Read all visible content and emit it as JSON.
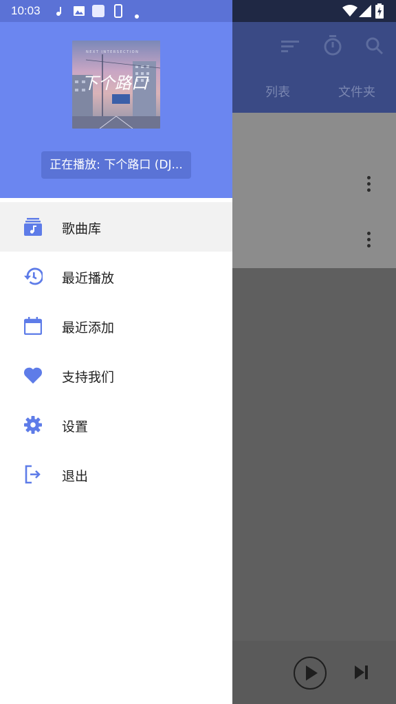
{
  "status_bar": {
    "time": "10:03",
    "icons": [
      "music-note-icon",
      "image-icon",
      "square-icon",
      "phone-icon",
      "dot-icon",
      "wifi-icon",
      "signal-icon",
      "battery-charging-icon"
    ]
  },
  "drawer": {
    "now_playing": "正在播放: 下个路口 (DJ...",
    "album_art_text": "下个路口",
    "album_art_caption": "NEXT INTERSECTION",
    "menu": [
      {
        "label": "歌曲库",
        "icon": "library-music-icon",
        "active": true
      },
      {
        "label": "最近播放",
        "icon": "history-icon",
        "active": false
      },
      {
        "label": "最近添加",
        "icon": "calendar-icon",
        "active": false
      },
      {
        "label": "支持我们",
        "icon": "heart-icon",
        "active": false
      },
      {
        "label": "设置",
        "icon": "gear-icon",
        "active": false
      },
      {
        "label": "退出",
        "icon": "logout-icon",
        "active": false
      }
    ]
  },
  "background_app": {
    "tabs": [
      "列表",
      "文件夹"
    ],
    "toolbar_icons": [
      "sort-icon",
      "timer-icon",
      "search-icon"
    ],
    "player_icons": [
      "play-icon",
      "skip-next-icon"
    ]
  },
  "colors": {
    "accent": "#6b86f0",
    "accent_dark": "#5b72d6",
    "icon_color": "#5e7ce8"
  }
}
